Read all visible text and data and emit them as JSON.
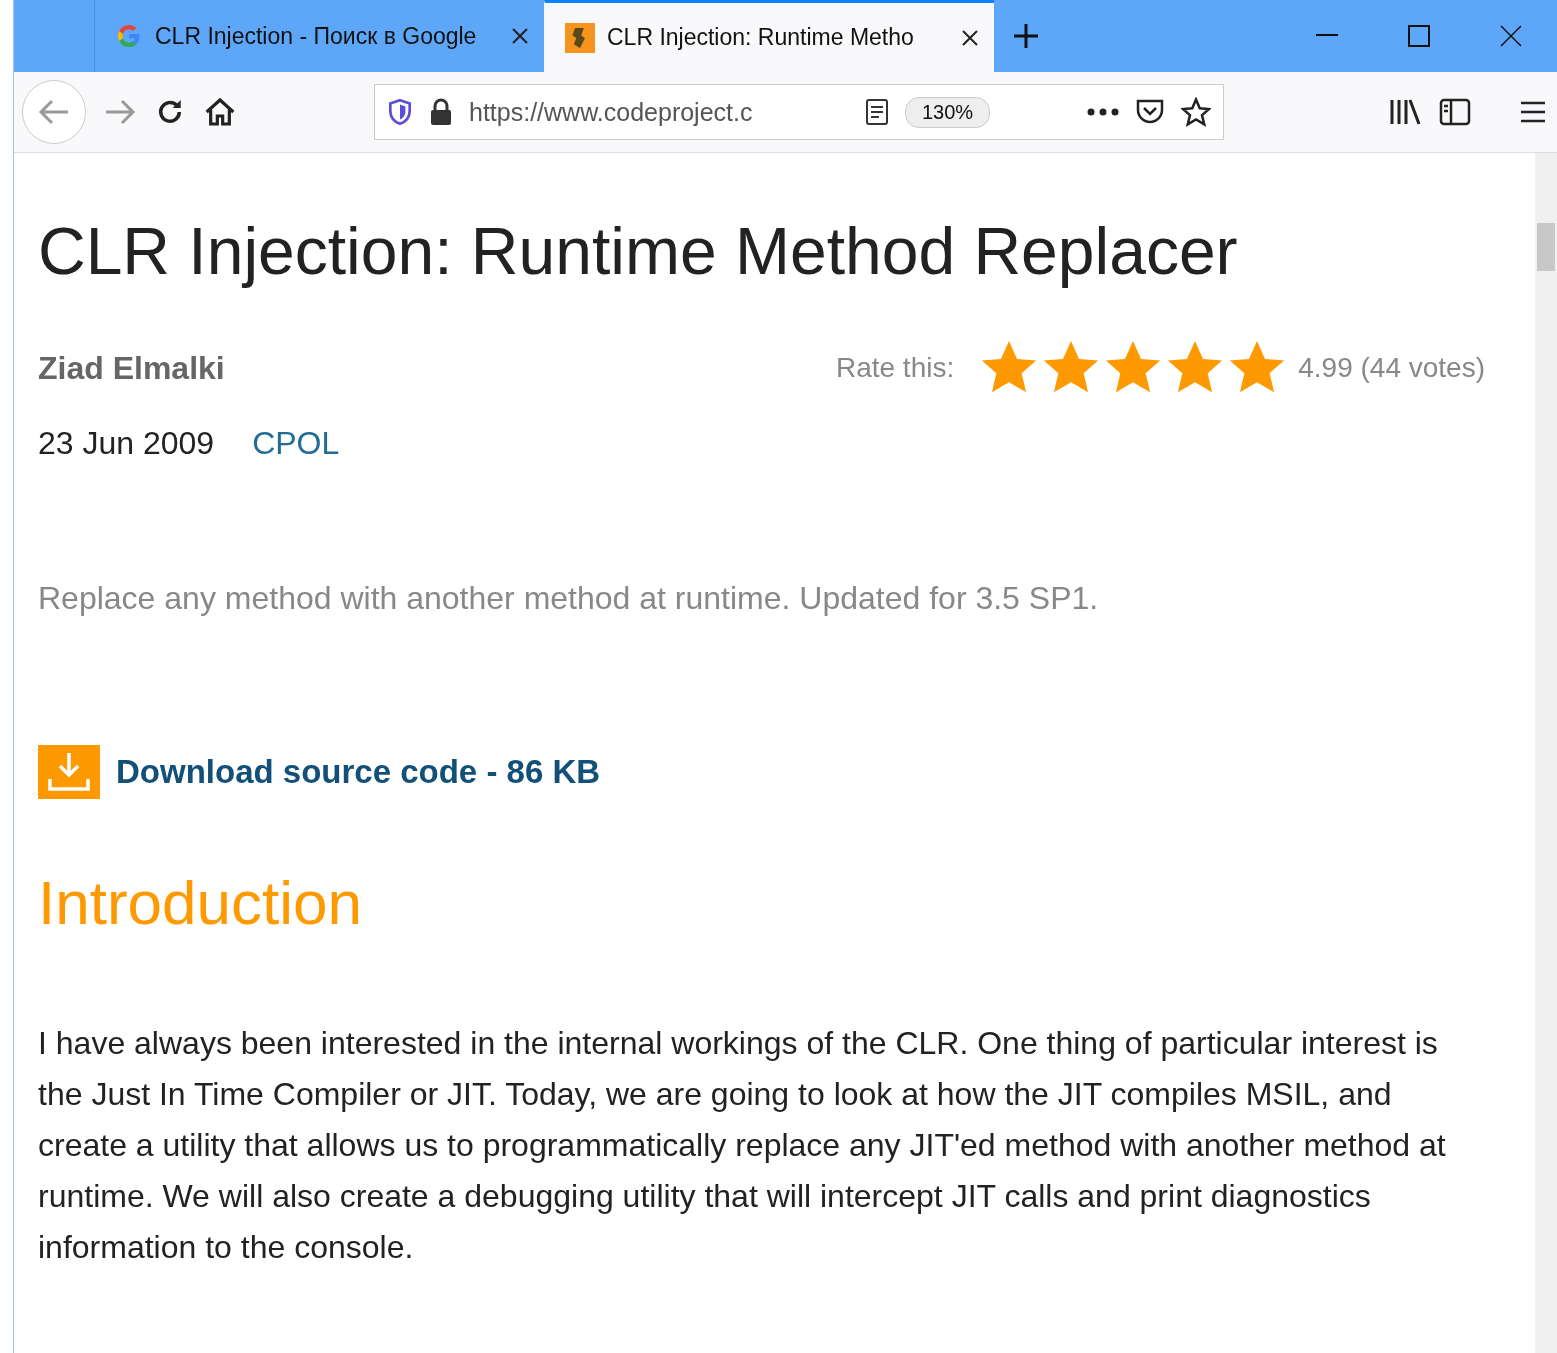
{
  "tabs": [
    {
      "kind": "google",
      "title": "CLR Injection - Поиск в Google",
      "selected": false
    },
    {
      "kind": "site",
      "title": "CLR Injection: Runtime Metho",
      "selected": true
    }
  ],
  "toolbar": {
    "url": "https://www.codeproject.c",
    "zoom": "130%"
  },
  "article": {
    "title": "CLR Injection: Runtime Method Replacer",
    "author": "Ziad Elmalki",
    "rate_label": "Rate this:",
    "stars": 5,
    "rating": "4.99 (44 votes)",
    "date": "23 Jun 2009",
    "license": "CPOL",
    "summary": "Replace any method with another method at runtime. Updated for 3.5 SP1.",
    "download": "Download source code - 86 KB",
    "heading": "Introduction",
    "paragraph": "I have always been interested in the internal workings of the CLR. One thing of particular interest is the Just In Time Compiler or JIT. Today, we are going to look at how the JIT compiles MSIL, and create a utility that allows us to programmatically replace any JIT'ed method with another method at runtime. We will also create a debugging utility that will intercept JIT calls and print diagnostics information to the console."
  }
}
